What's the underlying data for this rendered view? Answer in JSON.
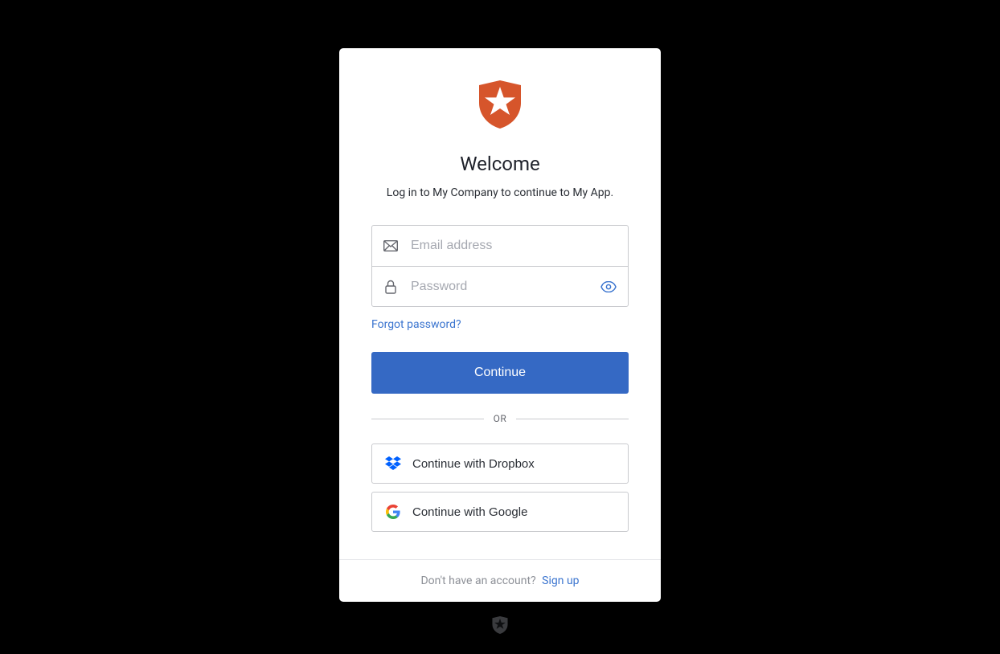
{
  "header": {
    "title": "Welcome",
    "subtitle": "Log in to My Company to continue to My App."
  },
  "form": {
    "email_placeholder": "Email address",
    "password_placeholder": "Password",
    "forgot_label": "Forgot password?",
    "continue_label": "Continue"
  },
  "divider": {
    "label": "OR"
  },
  "social": {
    "dropbox_label": "Continue with Dropbox",
    "google_label": "Continue with Google"
  },
  "footer": {
    "prompt": "Don't have an account?",
    "signup_label": "Sign up"
  },
  "colors": {
    "primary": "#3569c4",
    "link": "#3a74cf",
    "logo": "#d6552b"
  }
}
